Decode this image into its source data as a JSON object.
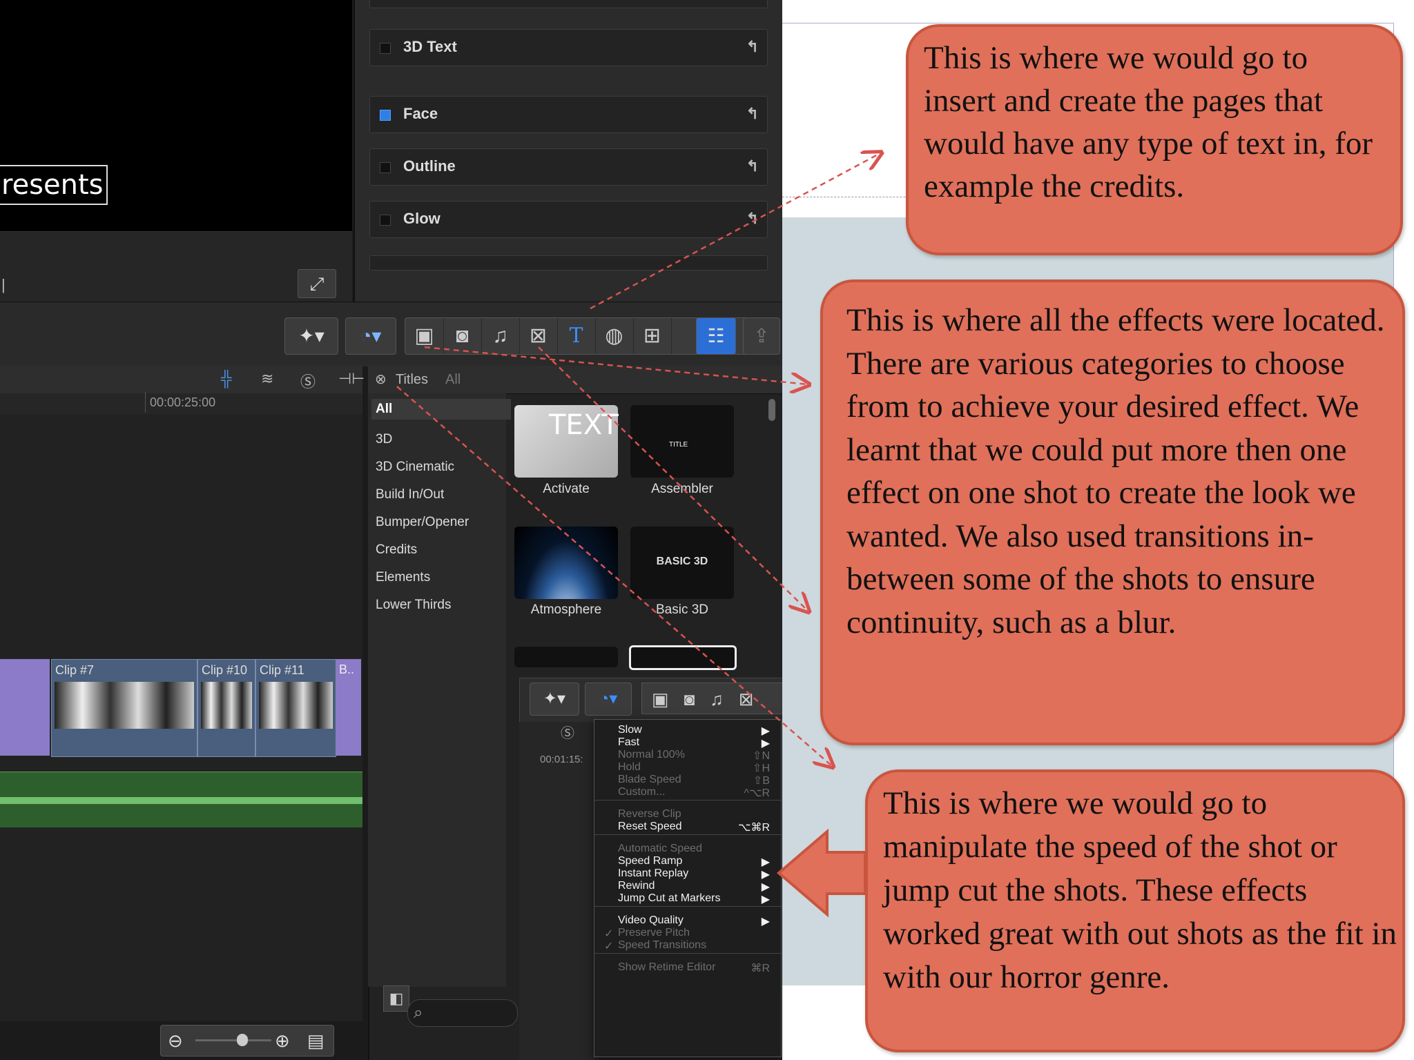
{
  "viewer": {
    "overlay_text": "resents"
  },
  "inspector": {
    "rows": [
      {
        "label": "3D Text",
        "checked": false
      },
      {
        "label": "Face",
        "checked": true
      },
      {
        "label": "Outline",
        "checked": false
      },
      {
        "label": "Glow",
        "checked": false
      }
    ],
    "reset_glyph": "↰"
  },
  "timeline": {
    "timecode": "00:00:25:00",
    "clips": [
      "Clip #7",
      "Clip #10",
      "Clip #11",
      "B.."
    ]
  },
  "browser": {
    "title": "Titles",
    "title_scope": "All",
    "categories": [
      "All",
      "3D",
      "3D Cinematic",
      "Build In/Out",
      "Bumper/Opener",
      "Credits",
      "Elements",
      "Lower Thirds"
    ],
    "tiles": [
      {
        "name": "Activate",
        "thumb": "TEXT"
      },
      {
        "name": "Assembler",
        "thumb": "TITLE"
      },
      {
        "name": "Atmosphere",
        "thumb": ""
      },
      {
        "name": "Basic 3D",
        "thumb": "BASIC 3D"
      }
    ]
  },
  "retime_menu": {
    "timecode": "00:01:15:",
    "items": [
      {
        "label": "Slow",
        "shortcut": "",
        "enabled": true,
        "submenu": true
      },
      {
        "label": "Fast",
        "shortcut": "",
        "enabled": true,
        "submenu": true
      },
      {
        "label": "Normal 100%",
        "shortcut": "⇧N",
        "enabled": false
      },
      {
        "label": "Hold",
        "shortcut": "⇧H",
        "enabled": false
      },
      {
        "label": "Blade Speed",
        "shortcut": "⇧B",
        "enabled": false
      },
      {
        "label": "Custom...",
        "shortcut": "^⌥R",
        "enabled": false
      },
      {
        "label": "Reverse Clip",
        "shortcut": "",
        "enabled": false
      },
      {
        "label": "Reset Speed",
        "shortcut": "⌥⌘R",
        "enabled": true
      },
      {
        "label": "Automatic Speed",
        "shortcut": "",
        "enabled": false
      },
      {
        "label": "Speed Ramp",
        "shortcut": "",
        "enabled": true,
        "submenu": true
      },
      {
        "label": "Instant Replay",
        "shortcut": "",
        "enabled": true,
        "submenu": true
      },
      {
        "label": "Rewind",
        "shortcut": "",
        "enabled": true,
        "submenu": true
      },
      {
        "label": "Jump Cut at Markers",
        "shortcut": "",
        "enabled": true,
        "submenu": true
      },
      {
        "label": "Video Quality",
        "shortcut": "",
        "enabled": true,
        "submenu": true
      },
      {
        "label": "Preserve Pitch",
        "shortcut": "",
        "enabled": false,
        "checked": true
      },
      {
        "label": "Speed Transitions",
        "shortcut": "",
        "enabled": false,
        "checked": true
      },
      {
        "label": "Show Retime Editor",
        "shortcut": "⌘R",
        "enabled": false
      }
    ]
  },
  "callouts": {
    "top": "This is where we would go to insert and create the pages that would have any type of text in, for example the credits.",
    "middle": "This is where all the effects were located. There are various categories to choose from to achieve your desired effect. We learnt that we could put more then one effect on one shot to create the look we wanted. We also used transitions in-between  some of the shots to ensure continuity, such as a blur.",
    "bottom": "This is where we would go to manipulate the speed of the shot or jump cut the shots. These effects worked great with out shots as the fit in with our horror genre."
  },
  "colors": {
    "callout_fill": "#e0705a",
    "callout_border": "#c9553e",
    "arrow": "#d9534f",
    "accent_blue": "#2f7fe6"
  },
  "icons": [
    "magic-wand-icon",
    "retime-icon",
    "photos-icon",
    "camera-icon",
    "music-icon",
    "transitions-icon",
    "titles-icon",
    "generators-icon",
    "themes-icon",
    "effects-list-icon",
    "share-icon"
  ]
}
